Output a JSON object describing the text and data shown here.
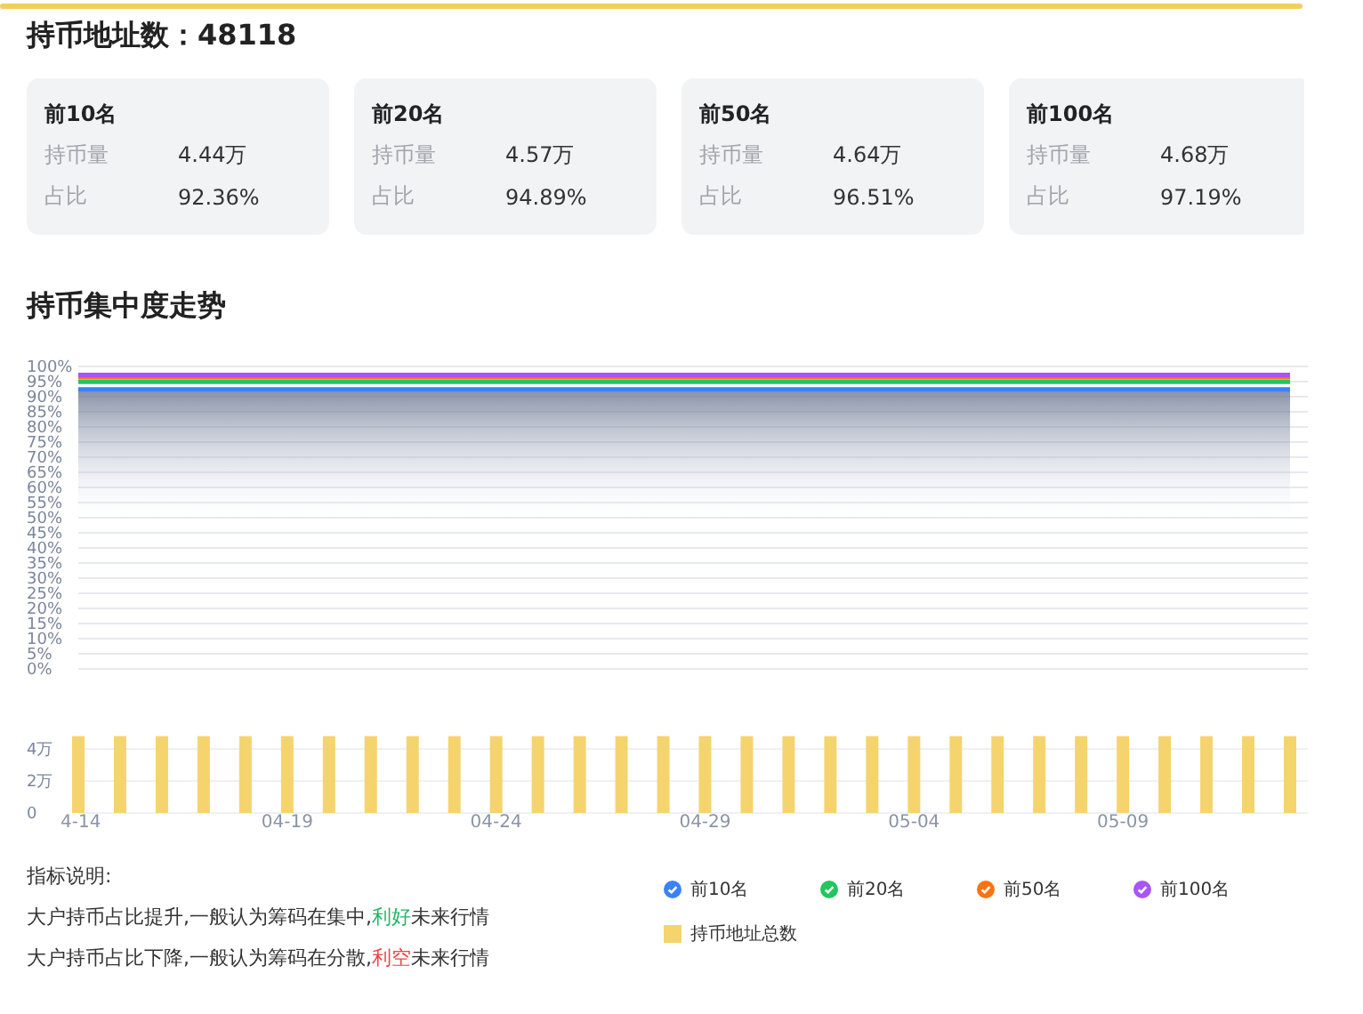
{
  "header": {
    "title": "持币地址数：48118"
  },
  "cards": [
    {
      "title": "前10名",
      "rows": [
        {
          "label": "持币量",
          "value": "4.44万"
        },
        {
          "label": "占比",
          "value": "92.36%"
        }
      ]
    },
    {
      "title": "前20名",
      "rows": [
        {
          "label": "持币量",
          "value": "4.57万"
        },
        {
          "label": "占比",
          "value": "94.89%"
        }
      ]
    },
    {
      "title": "前50名",
      "rows": [
        {
          "label": "持币量",
          "value": "4.64万"
        },
        {
          "label": "占比",
          "value": "96.51%"
        }
      ]
    },
    {
      "title": "前100名",
      "rows": [
        {
          "label": "持币量",
          "value": "4.68万"
        },
        {
          "label": "占比",
          "value": "97.19%"
        }
      ]
    }
  ],
  "trend": {
    "title": "持币集中度走势",
    "charts": [
      {
        "chart_data": {
          "type": "line",
          "grid": true,
          "ylim": [
            0,
            100
          ],
          "yticks": [
            {
              "value": 0,
              "label": "0%"
            },
            {
              "value": 5,
              "label": "5%"
            },
            {
              "value": 10,
              "label": "10%"
            },
            {
              "value": 15,
              "label": "15%"
            },
            {
              "value": 20,
              "label": "20%"
            },
            {
              "value": 25,
              "label": "25%"
            },
            {
              "value": 30,
              "label": "30%"
            },
            {
              "value": 35,
              "label": "35%"
            },
            {
              "value": 40,
              "label": "40%"
            },
            {
              "value": 45,
              "label": "45%"
            },
            {
              "value": 50,
              "label": "50%"
            },
            {
              "value": 55,
              "label": "55%"
            },
            {
              "value": 60,
              "label": "60%"
            },
            {
              "value": 65,
              "label": "65%"
            },
            {
              "value": 70,
              "label": "70%"
            },
            {
              "value": 75,
              "label": "75%"
            },
            {
              "value": 80,
              "label": "80%"
            },
            {
              "value": 85,
              "label": "85%"
            },
            {
              "value": 90,
              "label": "90%"
            },
            {
              "value": 95,
              "label": "95%"
            },
            {
              "value": 100,
              "label": "100%"
            }
          ],
          "series": [
            {
              "name": "前10名",
              "color": "#3b82f6",
              "values": [
                92.4,
                92.4,
                92.4,
                92.4,
                92.4,
                92.4,
                92.4,
                92.4,
                92.4,
                92.4,
                92.4,
                92.4,
                92.4,
                92.4,
                92.4,
                92.4,
                92.4,
                92.4,
                92.4,
                92.4,
                92.4,
                92.4,
                92.4,
                92.4,
                92.4,
                92.4,
                92.4,
                92.4,
                92.4,
                92.4
              ]
            },
            {
              "name": "前20名",
              "color": "#22c55e",
              "values": [
                94.9,
                94.9,
                94.9,
                94.9,
                94.9,
                94.9,
                94.9,
                94.9,
                94.9,
                94.9,
                94.9,
                94.9,
                94.9,
                94.9,
                94.9,
                94.9,
                94.9,
                94.9,
                94.9,
                94.9,
                94.9,
                94.9,
                94.9,
                94.9,
                94.9,
                94.9,
                94.9,
                94.9,
                94.9,
                94.9
              ]
            },
            {
              "name": "前50名",
              "color": "#f97316",
              "values": [
                96.5,
                96.5,
                96.5,
                96.5,
                96.5,
                96.5,
                96.5,
                96.5,
                96.5,
                96.5,
                96.5,
                96.5,
                96.5,
                96.5,
                96.5,
                96.5,
                96.5,
                96.5,
                96.5,
                96.5,
                96.5,
                96.5,
                96.5,
                96.5,
                96.5,
                96.5,
                96.5,
                96.5,
                96.5,
                96.5
              ]
            },
            {
              "name": "前100名",
              "color": "#a855f7",
              "values": [
                97.2,
                97.2,
                97.2,
                97.2,
                97.2,
                97.2,
                97.2,
                97.2,
                97.2,
                97.2,
                97.2,
                97.2,
                97.2,
                97.2,
                97.2,
                97.2,
                97.2,
                97.2,
                97.2,
                97.2,
                97.2,
                97.2,
                97.2,
                97.2,
                97.2,
                97.2,
                97.2,
                97.2,
                97.2,
                97.2
              ]
            }
          ]
        }
      },
      {
        "chart_data": {
          "type": "bar",
          "grid": true,
          "categories": [
            "4-14",
            null,
            null,
            null,
            null,
            "04-19",
            null,
            null,
            null,
            null,
            "04-24",
            null,
            null,
            null,
            null,
            "04-29",
            null,
            null,
            null,
            null,
            "05-04",
            null,
            null,
            null,
            null,
            "05-09",
            null,
            null,
            null,
            null
          ],
          "ylim": [
            0,
            5
          ],
          "yticks": [
            {
              "value": 0,
              "label": "0"
            },
            {
              "value": 2,
              "label": "2万"
            },
            {
              "value": 4,
              "label": "4万"
            }
          ],
          "series": [
            {
              "name": "持币地址总数",
              "color": "#f5d46e",
              "values": [
                4.8,
                4.8,
                4.8,
                4.8,
                4.8,
                4.8,
                4.8,
                4.8,
                4.8,
                4.8,
                4.8,
                4.8,
                4.8,
                4.8,
                4.8,
                4.8,
                4.8,
                4.8,
                4.8,
                4.8,
                4.8,
                4.8,
                4.8,
                4.8,
                4.8,
                4.8,
                4.8,
                4.8,
                4.8,
                4.8
              ]
            }
          ]
        }
      }
    ]
  },
  "notes": {
    "title": "指标说明:",
    "lines": [
      {
        "before": "大户持币占比提升,一般认为筹码在集中,",
        "highlight": "利好",
        "kind": "good",
        "after": "未来行情"
      },
      {
        "before": "大户持币占比下降,一般认为筹码在分散,",
        "highlight": "利空",
        "kind": "bad",
        "after": "未来行情"
      }
    ]
  }
}
